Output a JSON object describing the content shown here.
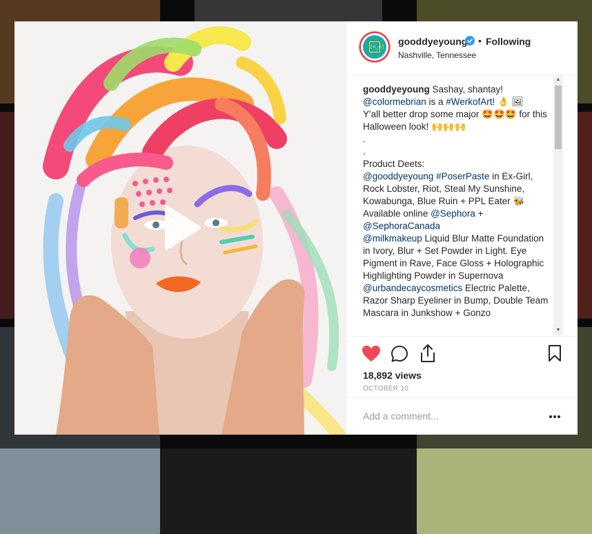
{
  "post": {
    "username": "gooddyeyoung",
    "separator": "•",
    "follow_label": "Following",
    "location": "Nashville, Tennessee",
    "avatar_text": "[ʘ‿ʘ]"
  },
  "caption": {
    "segments": [
      {
        "text": "gooddyeyoung",
        "type": "user"
      },
      {
        "text": " Sashay, shantay!\n",
        "type": "text"
      },
      {
        "text": "@colormebrian",
        "type": "tag"
      },
      {
        "text": " is a ",
        "type": "text"
      },
      {
        "text": "#WerkofArt!",
        "type": "tag"
      },
      {
        "text": " 👌 🖼\nY'all better drop some major 🤩🤩🤩 for this Halloween look! 🙌🙌🙌\n.\n.\nProduct Deets:\n",
        "type": "text"
      },
      {
        "text": "@gooddyeyoung",
        "type": "tag"
      },
      {
        "text": " ",
        "type": "text"
      },
      {
        "text": "#PoserPaste",
        "type": "tag"
      },
      {
        "text": " in Ex-Girl, Rock Lobster, Riot, Steal My Sunshine, Kowabunga, Blue Ruin + PPL Eater 🐝\nAvailable online ",
        "type": "text"
      },
      {
        "text": "@Sephora",
        "type": "tag"
      },
      {
        "text": " +\n",
        "type": "text"
      },
      {
        "text": "@SephoraCanada",
        "type": "tag"
      },
      {
        "text": "\n",
        "type": "text"
      },
      {
        "text": "@milkmakeup",
        "type": "tag"
      },
      {
        "text": " Liquid Blur Matte Foundation in Ivory, Blur + Set Powder in Light. Eye Pigment in Rave, Face Gloss + Holographic Highlighting Powder in Supernova\n",
        "type": "text"
      },
      {
        "text": "@urbandecaycosmetics",
        "type": "tag"
      },
      {
        "text": " Electric Palette, Razor Sharp Eyeliner in Bump, Double Team Mascara in Junkshow + Gonzo",
        "type": "text"
      }
    ]
  },
  "stats": {
    "views": "18,892 views",
    "date": "OCTOBER 10"
  },
  "comment": {
    "placeholder": "Add a comment..."
  },
  "icons": {
    "like": "heart-icon",
    "comment": "comment-icon",
    "share": "share-icon",
    "save": "bookmark-icon",
    "more": "more-icon",
    "play": "play-icon",
    "verified": "verified-badge-icon"
  },
  "colors": {
    "like_red": "#ed4956",
    "link_blue": "#003569",
    "verified_blue": "#3897f0",
    "avatar_teal": "#1fa9a3"
  }
}
